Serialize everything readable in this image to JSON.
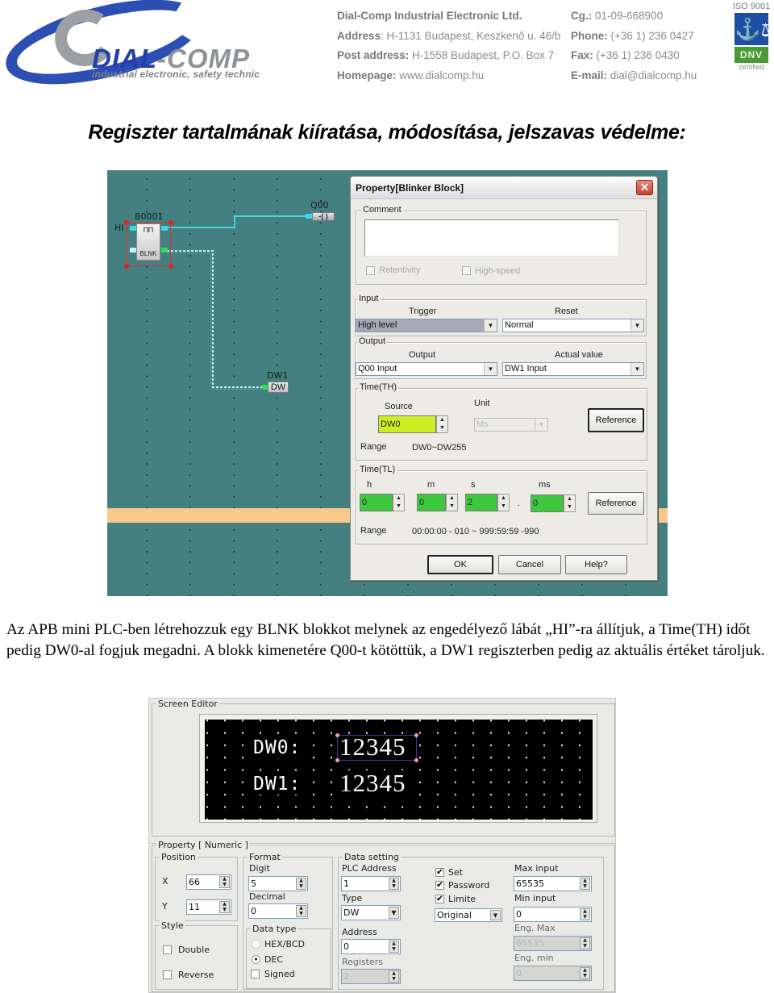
{
  "letterhead": {
    "logo_word_part1": "DIAL",
    "logo_word_part2": "-COMP",
    "logo_tagline": "industrial electronic, safety technic",
    "company": "Dial-Comp Industrial Electronic Ltd.",
    "address_label": "Address",
    "address_value": ": H-1131 Budapest, Keszkenő u. 46/b",
    "post_label": "Post address:",
    "post_value": " H-1558 Budapest, P.O. Box 7",
    "homepage_label": "Homepage:",
    "homepage_value": " www.dialcomp.hu",
    "cg_label": "Cg.:",
    "cg_value": " 01-09-668900",
    "phone_label": "Phone:",
    "phone_value": " (+36 1) 236 0427",
    "fax_label": "Fax:",
    "fax_value": " (+36 1) 236 0430",
    "email_label": "E-mail:",
    "email_value": " dial@dialcomp.hu",
    "iso_text": "ISO 9001",
    "iso_icon": "anchor-icon",
    "iso_glyph": "⚓⚖",
    "dnv_text": "DNV",
    "certified_text": "certified"
  },
  "title": "Regiszter tartalmának kiíratása, módosítása, jelszavas védelme:",
  "ladder": {
    "block_name": "B0001",
    "block_type": "BLNK",
    "block_symbol": "⊓⊓",
    "input_label": "HI",
    "coil_name": "Q00",
    "coil_symbol": "-( )",
    "dw_name": "DW1",
    "dw_box": "DW",
    "colors": {
      "background": "#44807f",
      "wire": "#3fd8e0",
      "highlight_stripe": "#fbc88b"
    }
  },
  "dialog": {
    "title": "Property[Blinker Block]",
    "close_glyph": "✕",
    "comment_label": "Comment",
    "comment_value": "",
    "retentivity_label": "Retentivity",
    "highspeed_label": "High-speed",
    "input_group": "Input",
    "trigger_label": "Trigger",
    "trigger_value": "High level",
    "reset_label": "Reset",
    "reset_value": "Normal",
    "output_group": "Output",
    "output_label": "Output",
    "output_value": "Q00  Input",
    "actual_label": "Actual value",
    "actual_value": "DW1  Input",
    "th_group": "Time(TH)",
    "source_label": "Source",
    "source_value": "DW0",
    "unit_label": "Unit",
    "unit_value": "Ms",
    "reference_label": "Reference",
    "th_range_label": "Range",
    "th_range_value": "DW0~DW255",
    "tl_group": "Time(TL)",
    "h_label": "h",
    "m_label": "m",
    "s_label": "s",
    "ms_label": "ms",
    "h_value": "0",
    "m_value": "0",
    "s_value": "2",
    "ms_value": "0",
    "dot": ".",
    "tl_reference_label": "Reference",
    "tl_range_label": "Range",
    "tl_range_value": "00:00:00 - 010 ~ 999:59:59 -990",
    "ok_label": "OK",
    "cancel_label": "Cancel",
    "help_label": "Help?",
    "arrow_down": "▼",
    "spin_glyph": "▲\n▼"
  },
  "paragraph": "Az APB mini PLC-ben létrehozzuk egy BLNK blokkot melynek az engedélyező lábát „HI”-ra állítjuk, a Time(TH) időt pedig DW0-al fogjuk megadni. A blokk kimenetére Q00-t kötöttük, a DW1 regiszterben pedig az aktuális értéket tároljuk.",
  "screen_editor": {
    "group_label": "Screen Editor",
    "row1_label": "DW0:",
    "row1_value": "12345",
    "row2_label": "DW1:",
    "row2_value": "12345",
    "property_label": "Property [ Numeric ]",
    "position_group": "Position",
    "x_label": "X",
    "x_value": "66",
    "y_label": "Y",
    "y_value": "11",
    "style_group": "Style",
    "double_label": "Double",
    "double_checked": false,
    "reverse_label": "Reverse",
    "reverse_checked": false,
    "format_group": "Format",
    "digit_label": "Digit",
    "digit_value": "5",
    "decimal_label": "Decimal",
    "decimal_value": "0",
    "datatype_group": "Data type",
    "hex_label": "HEX/BCD",
    "dec_label": "DEC",
    "selected_datatype": "DEC",
    "signed_label": "Signed",
    "signed_checked": false,
    "data_setting_group": "Data setting",
    "plc_address_label": "PLC Address",
    "plc_address_value": "1",
    "type_label": "Type",
    "type_value": "DW",
    "address_label": "Address",
    "address_value": "0",
    "registers_label": "Registers",
    "registers_value": "2",
    "set_label": "Set",
    "set_checked": true,
    "password_label": "Password",
    "password_checked": true,
    "limite_label": "Limite",
    "limite_checked": true,
    "mode_value": "Original",
    "max_input_label": "Max input",
    "max_input_value": "65535",
    "min_input_label": "Min input",
    "min_input_value": "0",
    "eng_max_label": "Eng. Max",
    "eng_max_value": "65535",
    "eng_min_label": "Eng. min",
    "eng_min_value": "0",
    "check_glyph": "✔",
    "radio_glyph": "●"
  }
}
